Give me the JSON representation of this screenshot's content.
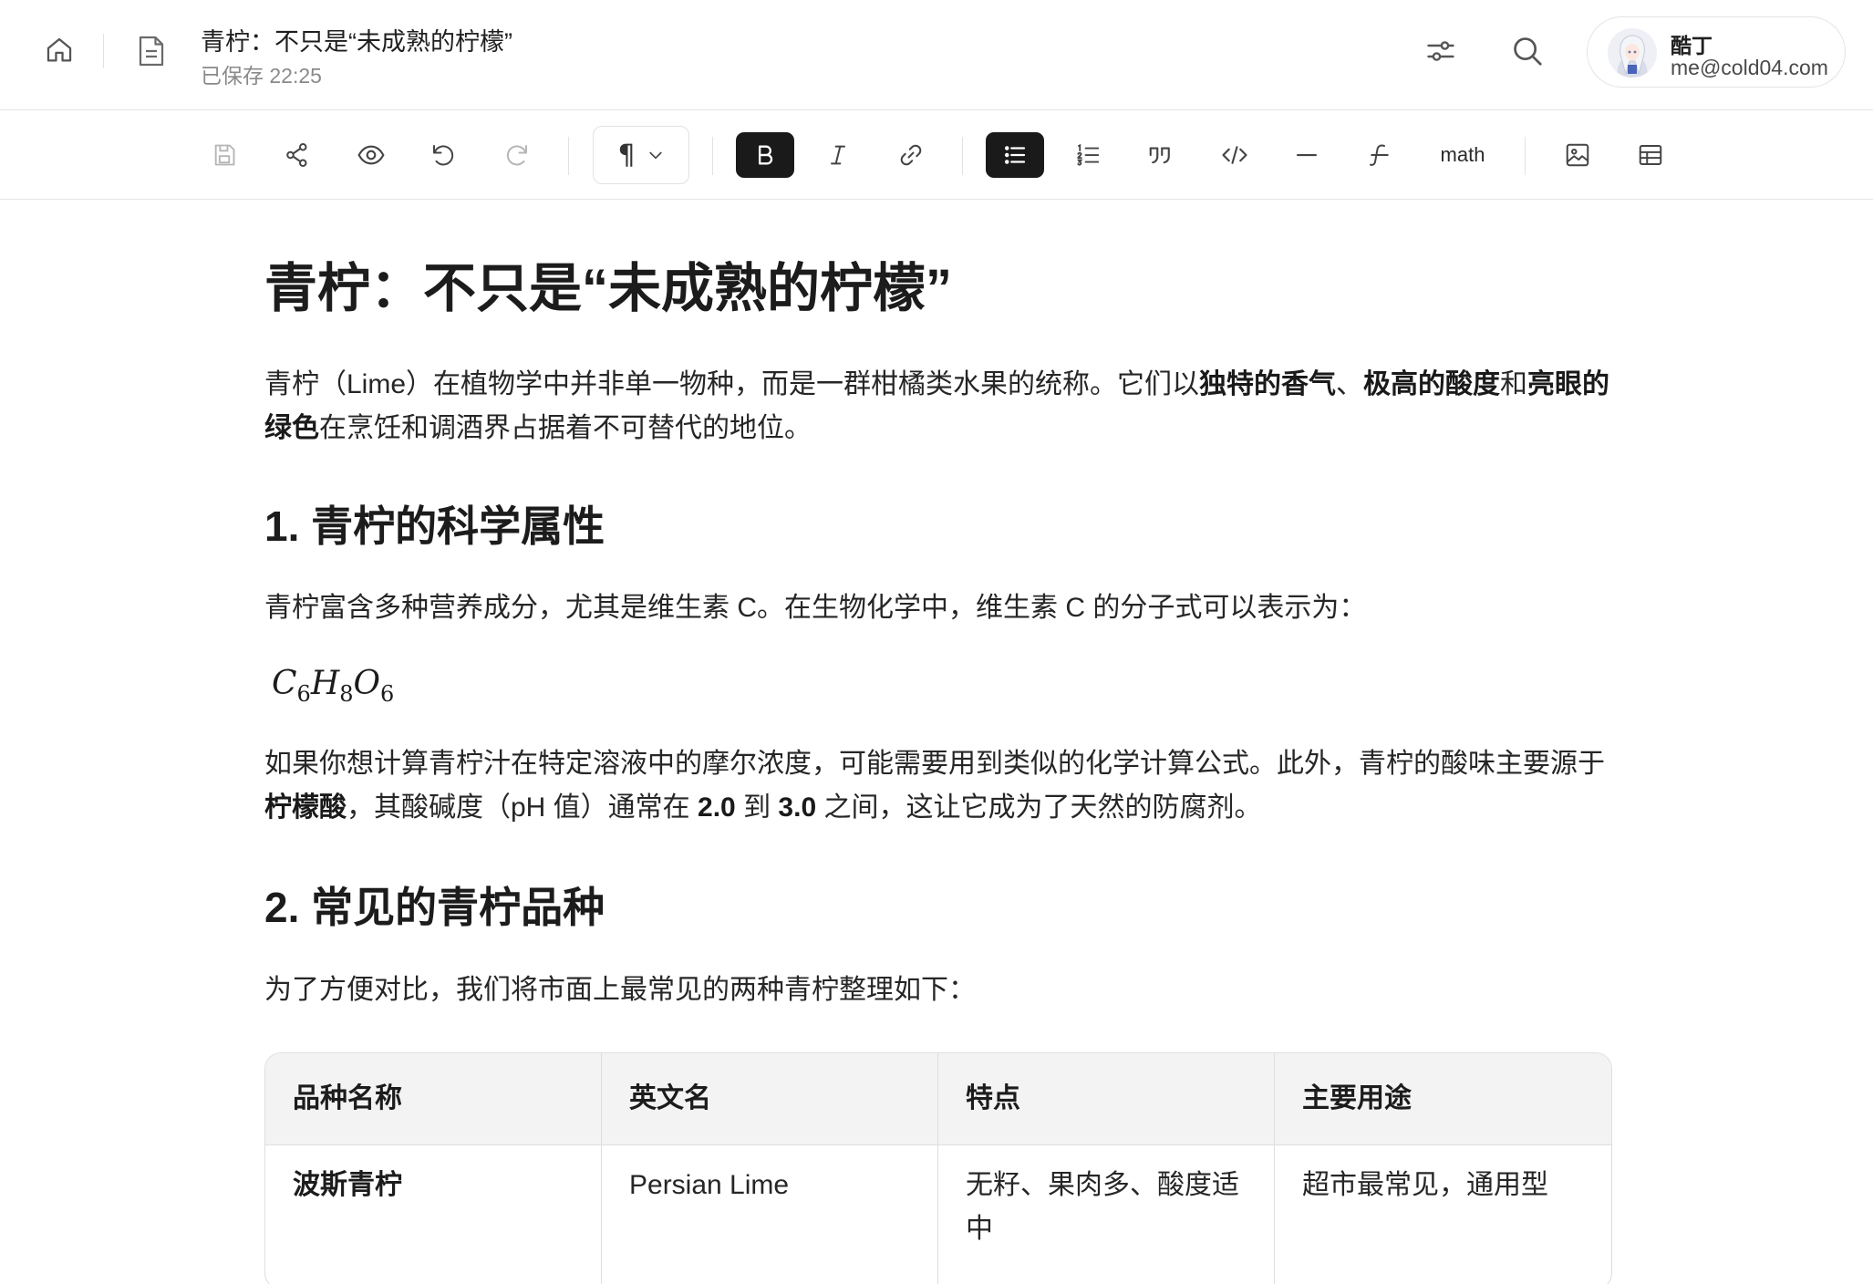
{
  "header": {
    "doc_title": "青柠：不只是“未成熟的柠檬”",
    "saved_status": "已保存 22:25",
    "user": {
      "name": "酷丁",
      "email": "me@cold04.com"
    },
    "icons": [
      "home-icon",
      "document-icon",
      "sliders-icon",
      "search-icon",
      "avatar"
    ]
  },
  "toolbar": {
    "paragraph_symbol": "¶",
    "math_label": "math",
    "icons": [
      "save-icon",
      "share-icon",
      "preview-icon",
      "undo-icon",
      "redo-icon",
      "paragraph-icon",
      "bold-icon",
      "italic-icon",
      "link-icon",
      "bullet-list-icon",
      "ordered-list-icon",
      "quote-icon",
      "code-icon",
      "horizontal-rule-icon",
      "strikethrough-icon",
      "image-icon",
      "table-icon"
    ],
    "active": [
      "bold",
      "bullet-list"
    ]
  },
  "article": {
    "title": "青柠：不只是“未成熟的柠檬”",
    "intro": {
      "t1": "青柠（Lime）在植物学中并非单一物种，而是一群柑橘类水果的统称。它们以",
      "b1": "独特的香气",
      "t2": "、",
      "b2": "极高的酸度",
      "t3": "和",
      "b3": "亮眼的绿色",
      "t4": "在烹饪和调酒界占据着不可替代的地位。"
    },
    "section1": {
      "heading": "1. 青柠的科学属性",
      "p1": "青柠富含多种营养成分，尤其是维生素 C。在生物化学中，维生素 C 的分子式可以表示为：",
      "formula": {
        "c": "C",
        "c_sub": "6",
        "h": "H",
        "h_sub": "8",
        "o": "O",
        "o_sub": "6"
      },
      "p2": {
        "t1": "如果你想计算青柠汁在特定溶液中的摩尔浓度，可能需要用到类似的化学计算公式。此外，青柠的酸味主要源于",
        "b1": "柠檬酸",
        "t2": "，其酸碱度（pH 值）通常在 ",
        "b2": "2.0",
        "t3": " 到 ",
        "b3": "3.0",
        "t4": " 之间，这让它成为了天然的防腐剂。"
      }
    },
    "section2": {
      "heading": "2. 常见的青柠品种",
      "p1": "为了方便对比，我们将市面上最常见的两种青柠整理如下：",
      "table": {
        "headers": [
          "品种名称",
          "英文名",
          "特点",
          "主要用途"
        ],
        "rows": [
          [
            "波斯青柠",
            "Persian Lime",
            "无籽、果肉多、酸度适中",
            "超市最常见，通用型"
          ]
        ]
      }
    }
  },
  "colors": {
    "accent_dark": "#1a1a1a",
    "border": "#e4e4e4",
    "muted_text": "#8a8a8a",
    "table_header_bg": "#f3f3f3"
  }
}
